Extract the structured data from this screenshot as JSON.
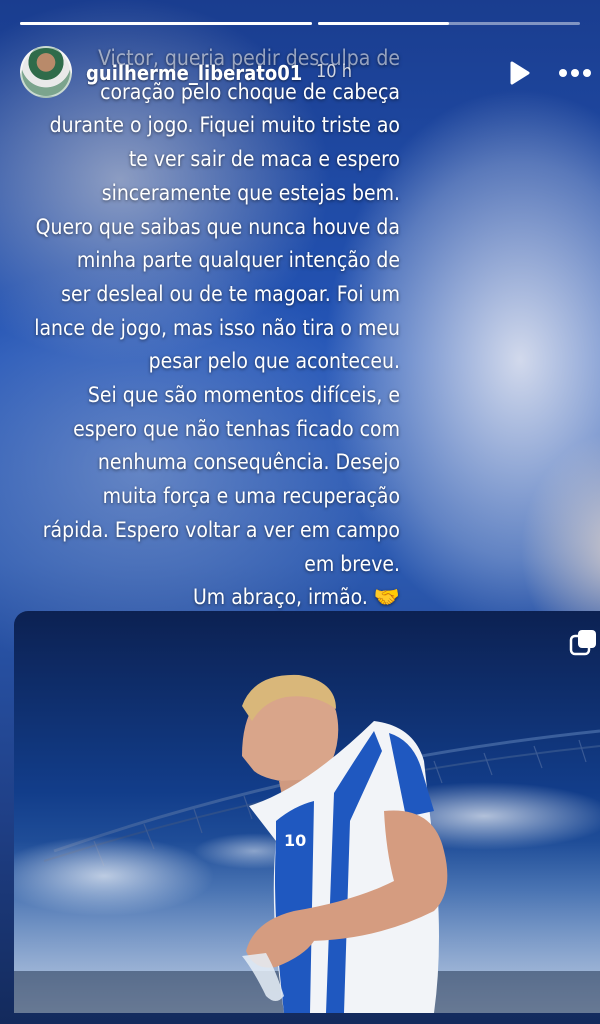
{
  "story": {
    "progress": [
      1.0,
      0.5
    ],
    "username": "guilherme_liberato01",
    "time": "10 h",
    "caption_lines": [
      "Victor, queria pedir desculpa de",
      "coração pelo choque de cabeça",
      "durante o jogo. Fiquei muito triste ao",
      "te ver sair de maca e espero",
      "sinceramente que estejas bem.",
      "Quero que saibas que nunca houve da",
      "minha parte qualquer intenção de",
      "ser desleal ou de te magoar. Foi um",
      "lance de jogo, mas isso não tira o meu",
      "pesar pelo que aconteceu.",
      "Sei que são momentos difíceis, e",
      "espero que não tenhas ficado com",
      "nenhuma consequência. Desejo",
      "muita força e uma recuperação",
      "rápida. Espero voltar a ver em campo",
      "em breve.",
      "Um abraço, irmão. 🤝"
    ]
  },
  "photo": {
    "jersey_number": "10"
  },
  "icons": {
    "play": "play-icon",
    "more": "more-options-icon",
    "copy": "multiple-media-icon"
  }
}
